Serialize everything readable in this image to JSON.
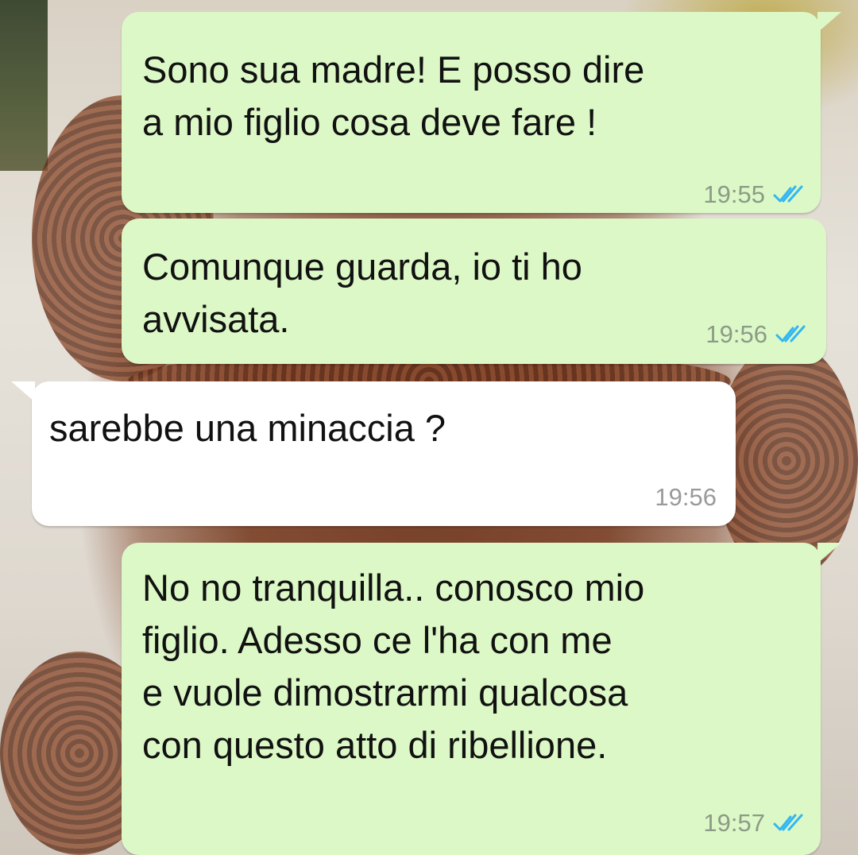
{
  "colors": {
    "outgoing_bubble": "#dcf8c6",
    "incoming_bubble": "#ffffff",
    "read_ticks": "#34b7f1",
    "timestamp": "#8c9a88"
  },
  "messages": [
    {
      "direction": "outgoing",
      "text": "Sono sua madre! E posso dire\na mio figlio cosa deve fare !",
      "time": "19:55",
      "status_icon": "double-check-read-icon"
    },
    {
      "direction": "outgoing",
      "text": "Comunque guarda, io ti ho\navvisata.",
      "time": "19:56",
      "status_icon": "double-check-read-icon"
    },
    {
      "direction": "incoming",
      "text": "sarebbe una minaccia ?",
      "time": "19:56"
    },
    {
      "direction": "outgoing",
      "text": "No no tranquilla.. conosco mio\nfiglio. Adesso ce l'ha con me\ne vuole dimostrarmi qualcosa\ncon questo atto di ribellione.",
      "time": "19:57",
      "status_icon": "double-check-read-icon"
    }
  ]
}
